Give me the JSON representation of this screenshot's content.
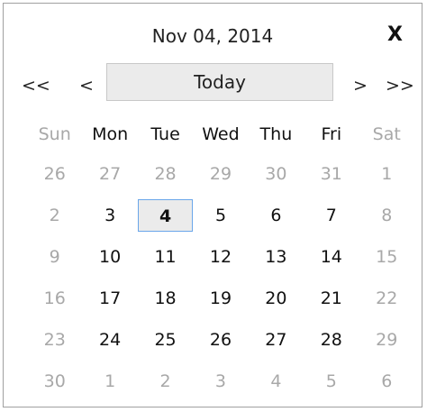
{
  "header": {
    "title": "Nov 04, 2014",
    "close": "X",
    "prev_year": "<<",
    "prev_month": "<",
    "today": "Today",
    "next_month": ">",
    "next_year": ">>"
  },
  "weekdays": [
    "Sun",
    "Mon",
    "Tue",
    "Wed",
    "Thu",
    "Fri",
    "Sat"
  ],
  "weeks": [
    [
      "26",
      "27",
      "28",
      "29",
      "30",
      "31",
      "1"
    ],
    [
      "2",
      "3",
      "4",
      "5",
      "6",
      "7",
      "8"
    ],
    [
      "9",
      "10",
      "11",
      "12",
      "13",
      "14",
      "15"
    ],
    [
      "16",
      "17",
      "18",
      "19",
      "20",
      "21",
      "22"
    ],
    [
      "23",
      "24",
      "25",
      "26",
      "27",
      "28",
      "29"
    ],
    [
      "30",
      "1",
      "2",
      "3",
      "4",
      "5",
      "6"
    ]
  ],
  "current_month_flags": [
    [
      false,
      false,
      false,
      false,
      false,
      false,
      false
    ],
    [
      false,
      true,
      true,
      true,
      true,
      true,
      false
    ],
    [
      false,
      true,
      true,
      true,
      true,
      true,
      false
    ],
    [
      false,
      true,
      true,
      true,
      true,
      true,
      false
    ],
    [
      false,
      true,
      true,
      true,
      true,
      true,
      false
    ],
    [
      false,
      false,
      false,
      false,
      false,
      false,
      false
    ]
  ],
  "selected_date": "4"
}
